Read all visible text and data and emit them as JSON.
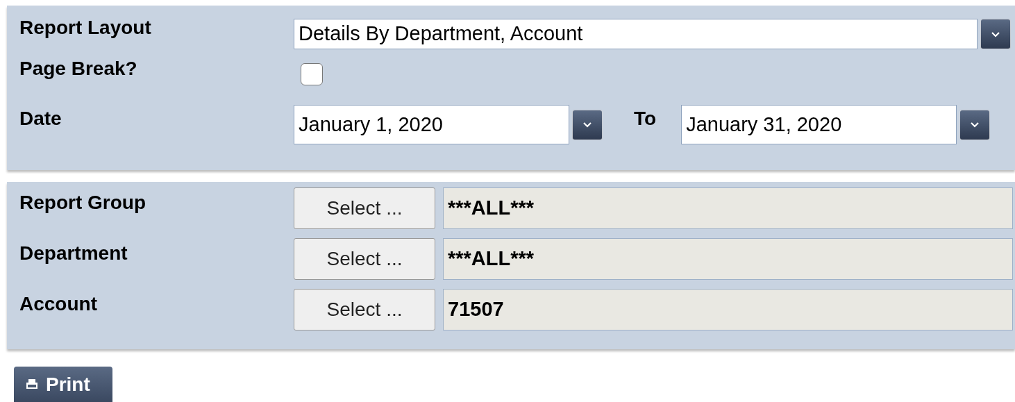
{
  "top_section": {
    "report_layout": {
      "label": "Report Layout",
      "value": "Details By Department, Account"
    },
    "page_break": {
      "label": "Page Break?",
      "checked": false
    },
    "date": {
      "label": "Date",
      "from": "January 1, 2020",
      "to_label": "To",
      "to": "January 31, 2020"
    }
  },
  "filters": [
    {
      "label": "Report Group",
      "button": "Select ...",
      "value": "***ALL***"
    },
    {
      "label": "Department",
      "button": "Select ...",
      "value": "***ALL***"
    },
    {
      "label": "Account",
      "button": "Select ...",
      "value": "71507"
    }
  ],
  "print_button": "Print"
}
